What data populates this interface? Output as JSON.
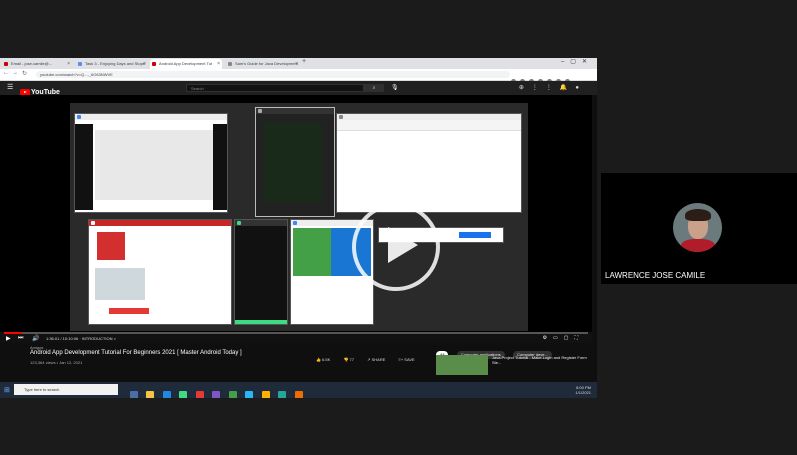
{
  "browser": {
    "tabs": [
      {
        "label": "Email - jose.camile@...",
        "active": false
      },
      {
        "label": "Task 3 - Enjoying Days and Stops",
        "active": false
      },
      {
        "label": "Android App Development Tut",
        "active": true
      },
      {
        "label": "Sam's Guide for Java Development",
        "active": false
      }
    ],
    "new_tab": "+",
    "url": "youtube.com/watch?v=Q-..._6O63NWVE"
  },
  "youtube": {
    "logo": "YouTube",
    "search_placeholder": "Search",
    "video": {
      "chapter": "1:36:01 / 10:10:06 · INTRODUCTION >",
      "progress": 0.03
    },
    "channel": "Amigos",
    "title": "Android App Development Tutorial For Beginners 2021 [ Master Android Today ]",
    "meta": "123,364 views • Jan 12, 2021",
    "actions": {
      "likes": "6.5K",
      "dislikes": "77",
      "share": "SHARE",
      "save": "SAVE"
    },
    "chips": [
      "All",
      "Computer applications",
      "Computer deve..."
    ],
    "recommendation": "Java Project Tutorial - Make Login and Register Form Ste..."
  },
  "taskbar": {
    "search_placeholder": "Type here to search",
    "time": "6:00 PM",
    "date": "1/1/2021"
  },
  "participant": {
    "name": "LAWRENCE JOSE CAMILE"
  },
  "colors": {
    "yt_red": "#ff0000",
    "background": "#1b1b1b",
    "shirt": "#b01c2a"
  }
}
